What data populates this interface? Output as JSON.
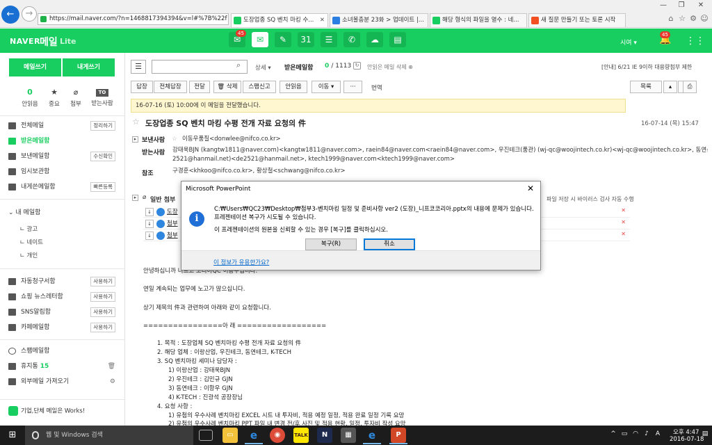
{
  "browser": {
    "address": "https://mail.naver.com/?n=1468817394394&v=l#%7B%22f",
    "tabs": [
      {
        "label": "도장업종 SQ 벤치 마킹 수...",
        "active": true,
        "color": "#19ce60"
      },
      {
        "label": "소녀볼충분 23화 > 업데이트 |...",
        "active": false,
        "color": "#2a7de1"
      },
      {
        "label": "해당 형식의 파일을 열수 : 네...",
        "active": false,
        "color": "#19ce60"
      },
      {
        "label": "새 질문 만들기 또는 토론 시작",
        "active": false,
        "color": "#f25022"
      }
    ]
  },
  "header": {
    "logo": "NAVER",
    "mail": "메일",
    "lite": "Lite",
    "mail_badge": "45",
    "user": "시여 ▾",
    "notif_badge": "45"
  },
  "sidebar": {
    "compose": "메일쓰기",
    "to_me": "내게쓰기",
    "quick": [
      {
        "value": "0",
        "label": "안읽음"
      },
      {
        "value": "★",
        "label": "중요"
      },
      {
        "value": "⌀",
        "label": "첨부"
      },
      {
        "value": "TO",
        "label": "받는사람"
      }
    ],
    "folders": [
      {
        "label": "전체메일",
        "btn": "정리하기"
      },
      {
        "label": "받은메일함",
        "btn": ""
      },
      {
        "label": "보낸메일함",
        "btn": "수신확인"
      },
      {
        "label": "임시보관함",
        "btn": ""
      },
      {
        "label": "내게쓴메일함",
        "btn": "빠른등록"
      }
    ],
    "my_folder": "내 메일함",
    "sub_folders": [
      "광고",
      "네이트",
      "개인"
    ],
    "smart": [
      {
        "label": "자동청구서함",
        "btn": "사용하기"
      },
      {
        "label": "쇼핑 뉴스레터함",
        "btn": "사용하기"
      },
      {
        "label": "SNS알림함",
        "btn": "사용하기"
      },
      {
        "label": "카페메일함",
        "btn": "사용하기"
      }
    ],
    "spam": "스팸메일함",
    "trash": "휴지통",
    "trash_count": "15",
    "external": "외부메일 가져오기",
    "promo": "기업,단체 메일은 Works!"
  },
  "toolbar": {
    "detail": "상세 ▾",
    "folder": "받은메일함",
    "count_now": "0",
    "count_total": "/ 1113",
    "autodel": "안읽은 메일 삭제 ⊕",
    "notice": "[안내] 6/21 IE 9이하 대용량첨부 제한",
    "buttons": [
      "답장",
      "전체답장",
      "전달",
      "🗑 삭제",
      "스팸신고",
      "안읽음",
      "이동 ▾",
      "···"
    ],
    "translate": "번역",
    "list_btn": "목록"
  },
  "mail": {
    "date_bar": "16-07-16 (토) 10:00에 이 메일을 전달했습니다.",
    "subject": "도장업종 SQ 벤치 마킹 수평 전개 자료 요청의 件",
    "date": "16-07-14 (목) 15:47",
    "from_label": "보낸사람",
    "from": "이동우품질<donwlee@nifco.co.kr>",
    "to_label": "받는사람",
    "to_line1": "강태욱BJN (kangtw1811@naver.com)<kangtw1811@naver.com>, raein84@naver.com<raein84@naver.com>, 우진테크(품관) (wj-qc@woojintech.co.kr)<wj-qc@woojintech.co.kr>, 동연산업 (de",
    "to_line2": "2521@hanmail.net)<de2521@hanmail.net>, ktech1999@naver.com<ktech1999@naver.com>",
    "cc_label": "참조",
    "cc": "구경훈<khkoo@nifco.co.kr>, 황상철<schwang@nifco.co.kr>",
    "attach_label": "일반 첨부",
    "scan_note": "파일 저장 시 바이러스 검사 자동 수행",
    "attachments": [
      "도장",
      "첨부",
      "첨부"
    ],
    "body": [
      "안녕하십니까 니프코 코리아QC 이동우입니다.",
      "연일 계속되는 업무에 노고가 많으십니다.",
      "상기 제목의 件과 관련하여 아래와 같이 요청합니다.",
      "================아 래 ==================",
      "1.   목적 : 도장업체 SQ 벤치마킹 수평 전개 자료 요청의 件",
      "2.   해당 업체 : 이랑산업, 우진테크, 동연테크, K-TECH",
      "3.   SQ 벤치마킹 세미나 담당자 :",
      "1)   이랑산업 : 강태욱BJN",
      "2)   우진테크 : 김민규 GJN",
      "3)   동연테크 : 이항우 GJN",
      "4)   K-TECH : 진광석 공장장님",
      "4.   요청 사항 :",
      "1)   유첨의 우수사례 벤치마킹 EXCEL 시트 내 투자비, 적용 예정 일정, 적용 완료 일정 기록 요망",
      "2)   유첨의 우수사례 벤치마킹 PPT 파일 내 변경 전/후 사진 및 적용 현황, 일정, 투자비 작성 요망"
    ]
  },
  "dialog": {
    "title": "Microsoft PowerPoint",
    "line1": "C:₩Users₩QC23₩Desktop₩첨부3-벤치마킹 일정 및 준비사항 ver2 (도장)_니프코코리아.pptx의 내용에 문제가 있습니다.",
    "line2": "프레젠테이션 복구가 시도될 수 있습니다.",
    "line3": "이 프레젠테이션의 원본을 신뢰할 수 있는 경우 [복구]를 클릭하십시오.",
    "repair": "복구(R)",
    "cancel": "취소",
    "link": "이 정보가 유용한가요?"
  },
  "taskbar": {
    "search": "웹 및 Windows 검색",
    "time": "오후 4:47",
    "date": "2016-07-18"
  }
}
